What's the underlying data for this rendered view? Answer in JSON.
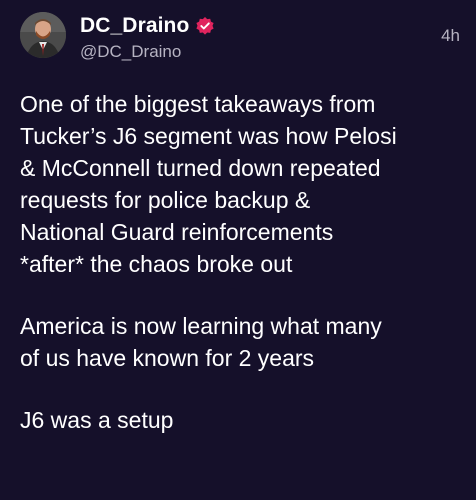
{
  "author": {
    "display_name": "DC_Draino",
    "handle": "@DC_Draino",
    "verified": true,
    "verified_color": "#e0245e"
  },
  "timestamp": "4h",
  "post": {
    "paragraphs": [
      {
        "lines": [
          "One of the biggest takeaways from",
          "Tucker’s J6 segment was how Pelosi",
          "& McConnell turned down repeated",
          "requests for police backup &",
          "National Guard reinforcements",
          "*after* the chaos broke out"
        ]
      },
      {
        "lines": [
          "America is now learning what many",
          "of us have known for 2 years"
        ]
      },
      {
        "lines": [
          "J6 was a setup"
        ]
      }
    ]
  },
  "colors": {
    "background": "#15102a",
    "text": "#ffffff",
    "secondary_text": "#b6b3c2"
  }
}
